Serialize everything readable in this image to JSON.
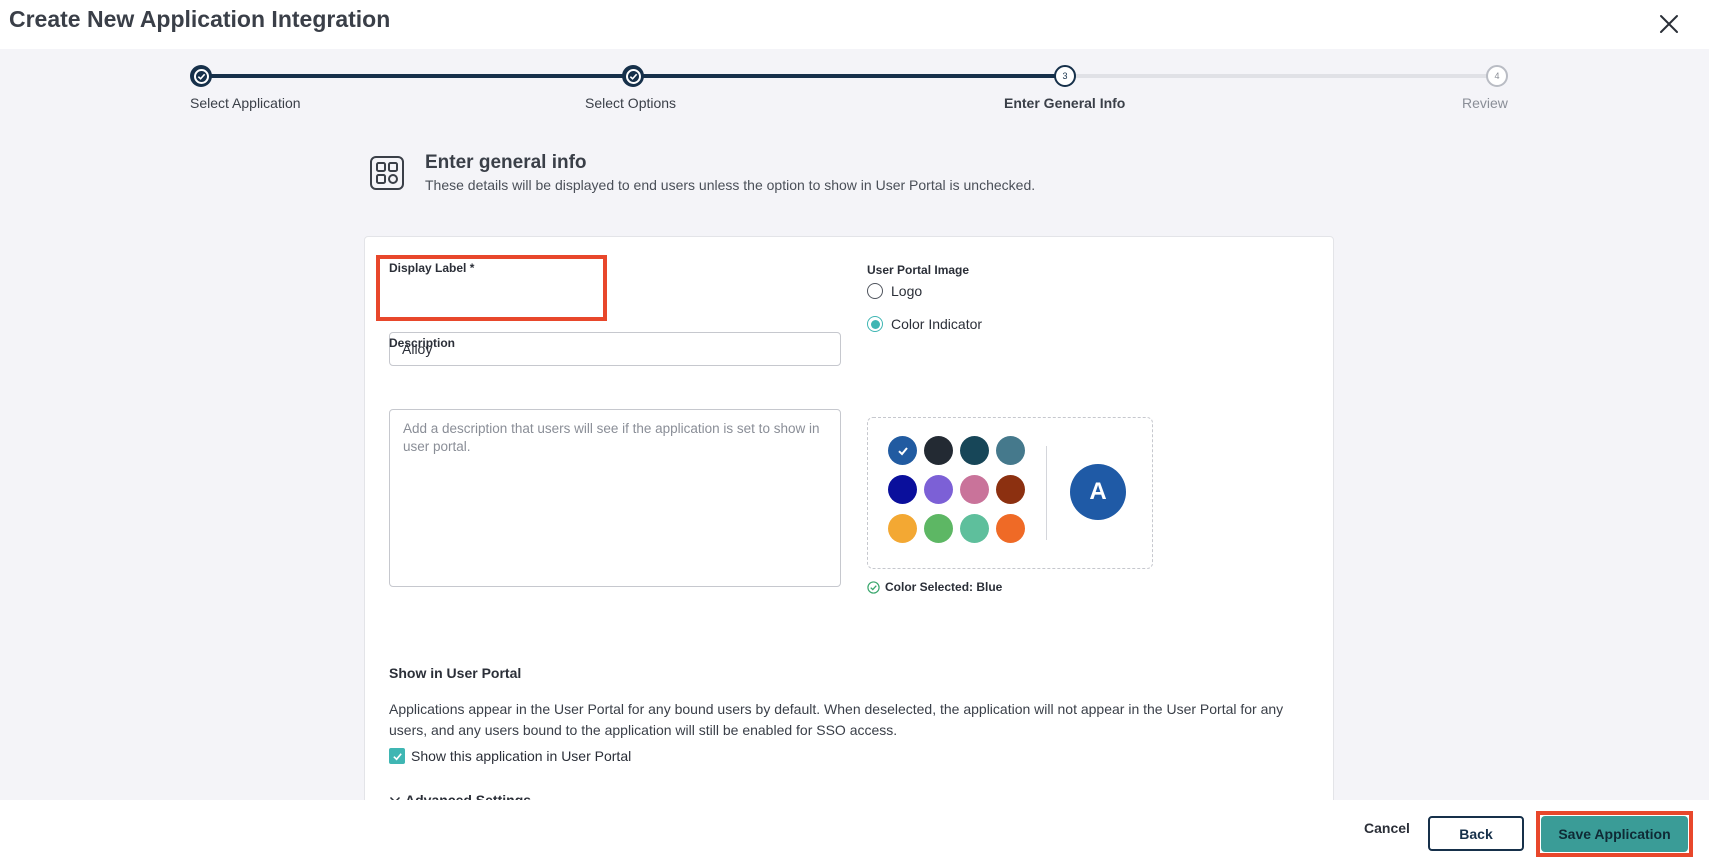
{
  "header": {
    "title": "Create New Application Integration",
    "close_icon": "close-icon"
  },
  "stepper": {
    "steps": [
      {
        "label": "Select Application",
        "state": "done"
      },
      {
        "label": "Select Options",
        "state": "done"
      },
      {
        "label": "Enter General Info",
        "number": "3",
        "state": "current"
      },
      {
        "label": "Review",
        "number": "4",
        "state": "future"
      }
    ]
  },
  "section": {
    "icon": "app-grid-icon",
    "title": "Enter general info",
    "subtitle": "These details will be displayed to end users unless the option to show in User Portal is unchecked."
  },
  "form": {
    "display_label": {
      "label": "Display Label *",
      "value": "Alloy"
    },
    "description": {
      "label": "Description",
      "placeholder": "Add a description that users will see if the application is set to show in user portal."
    },
    "portal_image": {
      "label": "User Portal Image",
      "options": [
        {
          "label": "Logo",
          "checked": false
        },
        {
          "label": "Color Indicator",
          "checked": true
        }
      ],
      "colors": [
        "#215ba1",
        "#232a33",
        "#174658",
        "#45798c",
        "#0a0f9c",
        "#7c60d6",
        "#c9739a",
        "#8c3010",
        "#f3a833",
        "#5db764",
        "#5ebf9c",
        "#ef6a26"
      ],
      "selected_index": 0,
      "avatar_letter": "A",
      "color_selected_text": "Color Selected: Blue"
    },
    "show_in_portal": {
      "title": "Show in User Portal",
      "description": "Applications appear in the User Portal for any bound users by default. When deselected, the application will not appear in the User Portal for any users, and any users bound to the application will still be enabled for SSO access.",
      "checkbox_label": "Show this application in User Portal",
      "checked": true
    },
    "advanced_label": "Advanced Settings"
  },
  "footer": {
    "cancel": "Cancel",
    "back": "Back",
    "save": "Save Application"
  },
  "colors": {
    "primary": "#16304a",
    "accent": "#3fb6b3",
    "save_bg": "#3a9c97",
    "highlight": "#e8472b"
  }
}
